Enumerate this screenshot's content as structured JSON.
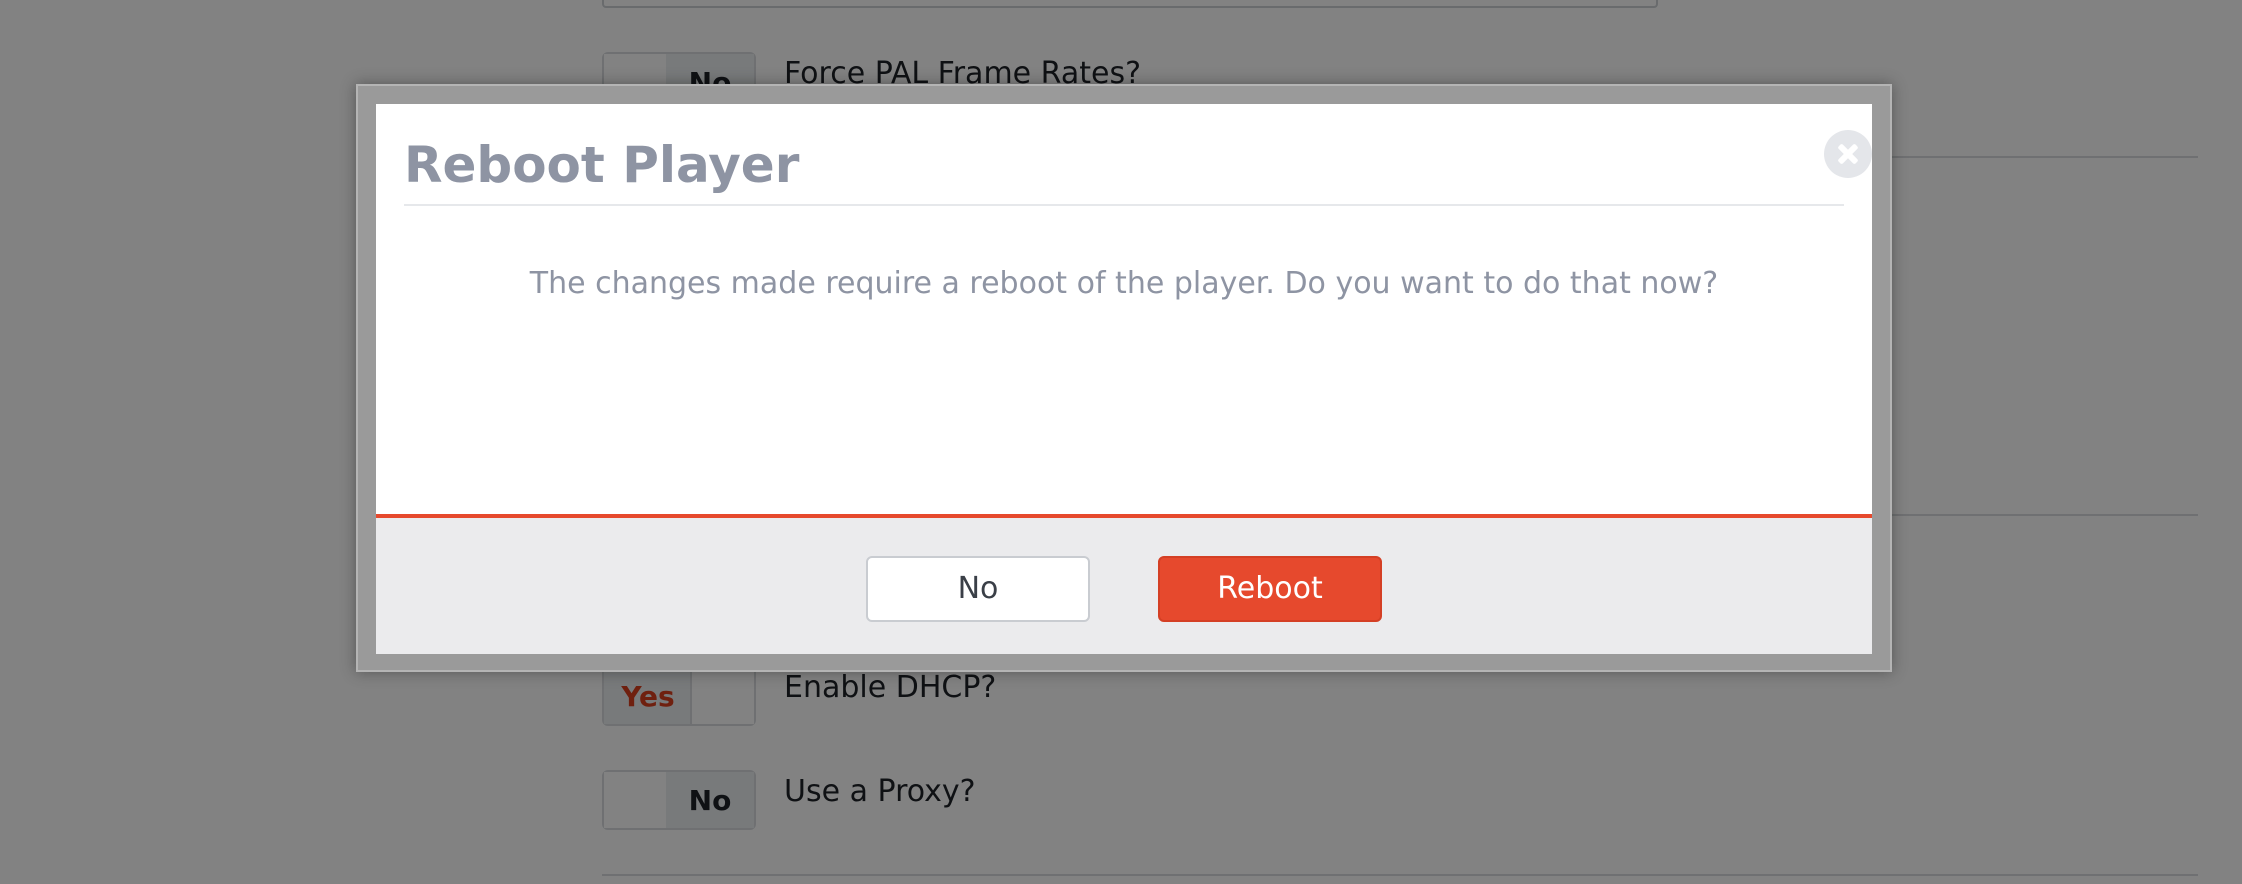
{
  "background": {
    "settings": [
      {
        "id": "force-pal",
        "label": "Force PAL Frame Rates?",
        "state": "No"
      },
      {
        "id": "enable-dhcp",
        "label": "Enable DHCP?",
        "state": "Yes"
      },
      {
        "id": "use-proxy",
        "label": "Use a Proxy?",
        "state": "No"
      }
    ]
  },
  "dialog": {
    "title": "Reboot Player",
    "message": "The changes made require a reboot of the player. Do you want to do that now?",
    "buttons": {
      "no_label": "No",
      "reboot_label": "Reboot"
    },
    "close_icon": "close-icon"
  },
  "colors": {
    "accent": "#e6492d",
    "title_text": "#8e94a3",
    "footer_bg": "#ebebed"
  }
}
